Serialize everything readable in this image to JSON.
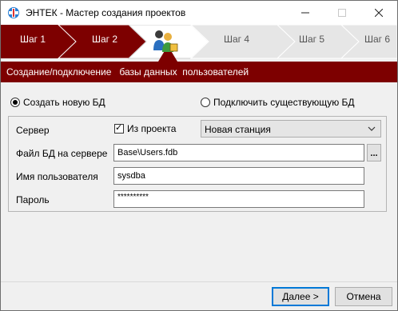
{
  "window": {
    "title": "ЭНТЕК - Мастер создания проектов"
  },
  "steps": [
    {
      "label": "Шаг 1",
      "state": "done"
    },
    {
      "label": "Шаг 2",
      "state": "done"
    },
    {
      "label": "",
      "state": "current",
      "icon": "users-database-icon"
    },
    {
      "label": "Шаг 4",
      "state": "pending"
    },
    {
      "label": "Шаг 5",
      "state": "pending"
    },
    {
      "label": "Шаг 6",
      "state": "pending"
    }
  ],
  "header": {
    "text": "Создание/подключение   базы данных  пользователей"
  },
  "options": {
    "create_new": {
      "label": "Создать новую БД",
      "checked": true
    },
    "connect_existing": {
      "label": "Подключить существующую БД",
      "checked": false
    }
  },
  "form": {
    "server_label": "Сервер",
    "from_project_label": "Из проекта",
    "from_project_checked": true,
    "server_value": "Новая станция",
    "db_file_label": "Файл БД на сервере",
    "db_file_value": "Base\\Users.fdb",
    "browse_label": "...",
    "username_label": "Имя пользователя",
    "username_value": "sysdba",
    "password_label": "Пароль",
    "password_value": "**********"
  },
  "buttons": {
    "next": "Далее >",
    "cancel": "Отмена"
  },
  "colors": {
    "accent": "#7d0000",
    "active_step": "#7d0000",
    "pending_step": "#e6e6e6"
  }
}
